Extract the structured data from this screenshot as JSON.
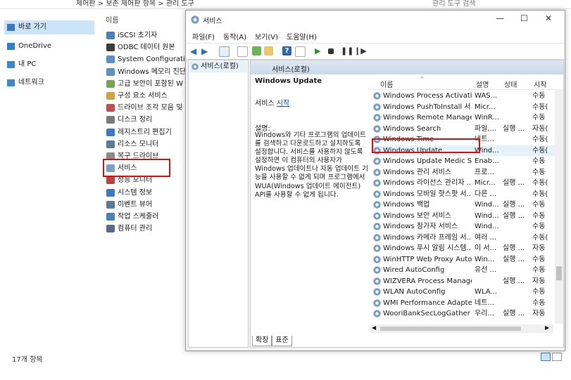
{
  "explorer": {
    "breadcrumb": "제어판  >  보존 제어판 항목  >  관리 도구",
    "search_placeholder": "관리 도구 검색",
    "nav": [
      {
        "label": "바로 가기",
        "icon": "star-icon",
        "color": "#3a78c9"
      },
      {
        "label": "OneDrive",
        "icon": "cloud-icon",
        "color": "#2a7fd4"
      },
      {
        "label": "내 PC",
        "icon": "computer-icon",
        "color": "#3a88d0"
      },
      {
        "label": "네트워크",
        "icon": "network-icon",
        "color": "#3a88d0"
      }
    ],
    "column_header": "이름",
    "files": [
      "iSCSI 초기자",
      "ODBC 데이터 원본",
      "System Configuration",
      "Windows 메모리 진단",
      "고급 보안이 포함된 W",
      "구성 요소 서비스",
      "드라이브 조각 모음 및",
      "디스크 정리",
      "레지스트리 편집기",
      "리소스 모니터",
      "복구 드라이브",
      "서비스",
      "성능 모니터",
      "시스템 정보",
      "이벤트 뷰어",
      "작업 스케줄러",
      "컴퓨터 관리"
    ],
    "item_count": "17개 항목"
  },
  "window": {
    "title": "서비스",
    "menu": [
      "파일(F)",
      "동작(A)",
      "보기(V)",
      "도움말(H)"
    ],
    "tree_item": "서비스(로컬)",
    "content_header": "서비스(로컬)",
    "desc": {
      "title": "Windows Update",
      "link_prefix": "서비스 ",
      "link": "시작",
      "label": "설명:",
      "text": "Windows와 기타 프로그램의 업데이트를 검색하고 다운로드하고 설치하도록 설정합니다. 서비스를 사용하지 않도록 설정하면 이 컴퓨터의 사용자가 Windows 업데이트나 자동 업데이트 기능을 사용할 수 없게 되며 프로그램에서 WUA(Windows 업데이트 에이전트) API를 사용할 수 없게 됩니다."
    },
    "columns": {
      "name": "이름",
      "desc": "설명",
      "status": "상태",
      "startup": "시작"
    },
    "services": [
      {
        "name": "Windows Process Activatio...",
        "desc": "WAS...",
        "status": "",
        "startup": "수동"
      },
      {
        "name": "Windows PushToInstall 서...",
        "desc": "Micr...",
        "status": "",
        "startup": "수동("
      },
      {
        "name": "Windows Remote Manage...",
        "desc": "WinR...",
        "status": "",
        "startup": "수동"
      },
      {
        "name": "Windows Search",
        "desc": "파일,...",
        "status": "실행 ...",
        "startup": "자동("
      },
      {
        "name": "Windows Time",
        "desc": "네트...",
        "status": "",
        "startup": "수동("
      },
      {
        "name": "Windows Update",
        "desc": "Wind...",
        "status": "",
        "startup": "수동("
      },
      {
        "name": "Windows Update Medic Se...",
        "desc": "Enab...",
        "status": "",
        "startup": "수동"
      },
      {
        "name": "Windows 관리 서비스",
        "desc": "프로...",
        "status": "",
        "startup": "수동"
      },
      {
        "name": "Windows 라이선스 관리자 ...",
        "desc": "Micr...",
        "status": "실행 ...",
        "startup": "수동("
      },
      {
        "name": "Windows 모바일 핫스팟 서...",
        "desc": "다른 ...",
        "status": "",
        "startup": "수동("
      },
      {
        "name": "Windows 백업",
        "desc": "Wind...",
        "status": "실행 ...",
        "startup": "수동"
      },
      {
        "name": "Windows 보안 서비스",
        "desc": "Wind...",
        "status": "실행 ...",
        "startup": "수동"
      },
      {
        "name": "Windows 참가자 서비스",
        "desc": "Wind...",
        "status": "",
        "startup": "수동"
      },
      {
        "name": "Windows 카메라 프레임 서...",
        "desc": "여러 ...",
        "status": "",
        "startup": "수동("
      },
      {
        "name": "Windows 푸시 알림 시스템...",
        "desc": "이 서...",
        "status": "실행 ...",
        "startup": "자동"
      },
      {
        "name": "WinHTTP Web Proxy Auto-...",
        "desc": "Win...",
        "status": "실행 ...",
        "startup": "수동"
      },
      {
        "name": "Wired AutoConfig",
        "desc": "유선 ...",
        "status": "",
        "startup": "수동"
      },
      {
        "name": "WIZVERA Process Manager...",
        "desc": "",
        "status": "실행 ...",
        "startup": "자동"
      },
      {
        "name": "WLAN AutoConfig",
        "desc": "WLA...",
        "status": "",
        "startup": "수동"
      },
      {
        "name": "WMI Performance Adapter",
        "desc": "네트...",
        "status": "",
        "startup": "수동"
      },
      {
        "name": "WooriBankSecLogGather",
        "desc": "우리...",
        "status": "실행 ...",
        "startup": "자동"
      }
    ],
    "tabs": [
      "확장",
      "표준"
    ]
  },
  "colors": {
    "highlight": "#e01010",
    "selection": "#e5f1fb",
    "link": "#0050c0"
  }
}
